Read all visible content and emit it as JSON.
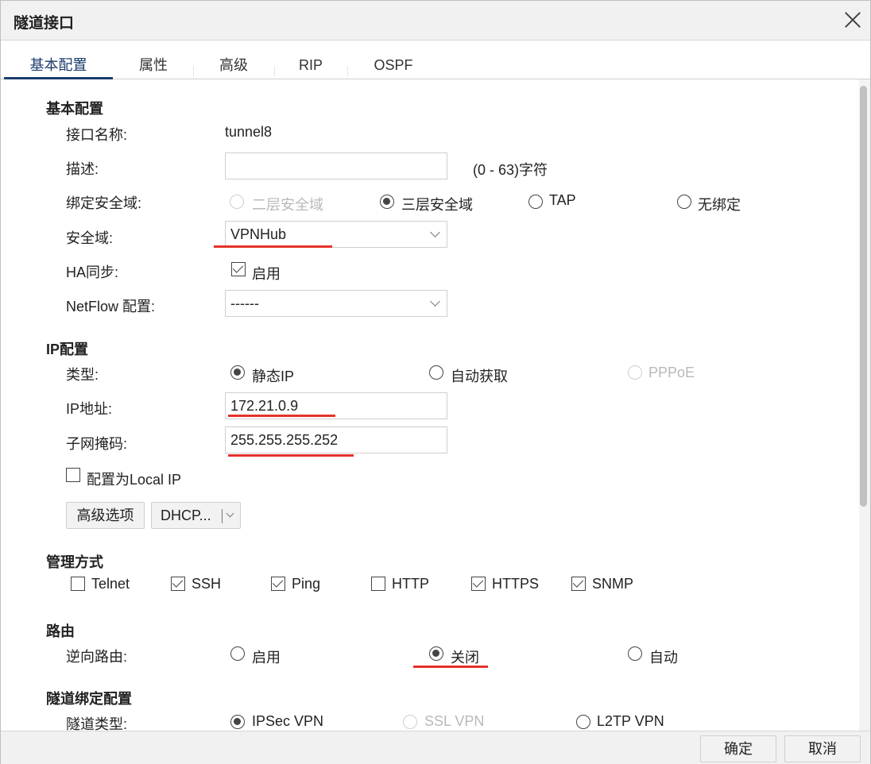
{
  "dialog": {
    "title": "隧道接口"
  },
  "tabs": [
    "基本配置",
    "属性",
    "高级",
    "RIP",
    "OSPF"
  ],
  "basic": {
    "section": "基本配置",
    "name_label": "接口名称:",
    "name_value": "tunnel8",
    "desc_label": "描述:",
    "desc_value": "",
    "desc_hint": "(0 - 63)字符",
    "bind_label": "绑定安全域:",
    "bind_options": [
      "二层安全域",
      "三层安全域",
      "TAP",
      "无绑定"
    ],
    "bind_selected": "三层安全域",
    "zone_label": "安全域:",
    "zone_value": "VPNHub",
    "ha_label": "HA同步:",
    "ha_option": "启用",
    "ha_checked": true,
    "netflow_label": "NetFlow 配置:",
    "netflow_value": "------"
  },
  "ip": {
    "section": "IP配置",
    "type_label": "类型:",
    "type_options": [
      "静态IP",
      "自动获取",
      "PPPoE"
    ],
    "type_selected": "静态IP",
    "addr_label": "IP地址:",
    "addr_value": "172.21.0.9",
    "mask_label": "子网掩码:",
    "mask_value": "255.255.255.252",
    "local_ip_label": "配置为Local IP",
    "local_ip_checked": false,
    "advanced_button": "高级选项",
    "dhcp_button": "DHCP..."
  },
  "management": {
    "section": "管理方式",
    "items": [
      {
        "label": "Telnet",
        "checked": false
      },
      {
        "label": "SSH",
        "checked": true
      },
      {
        "label": "Ping",
        "checked": true
      },
      {
        "label": "HTTP",
        "checked": false
      },
      {
        "label": "HTTPS",
        "checked": true
      },
      {
        "label": "SNMP",
        "checked": true
      }
    ]
  },
  "routing": {
    "section": "路由",
    "reverse_label": "逆向路由:",
    "options": [
      "启用",
      "关闭",
      "自动"
    ],
    "selected": "关闭"
  },
  "tunnel_binding": {
    "section": "隧道绑定配置",
    "type_label": "隧道类型:",
    "options": [
      "IPSec VPN",
      "SSL VPN",
      "L2TP VPN"
    ],
    "selected": "IPSec VPN"
  },
  "footer": {
    "ok": "确定",
    "cancel": "取消"
  },
  "colors": {
    "accent": "#1c3d6e",
    "highlight": "#e5322a",
    "disabled": "#b9b9b9"
  }
}
